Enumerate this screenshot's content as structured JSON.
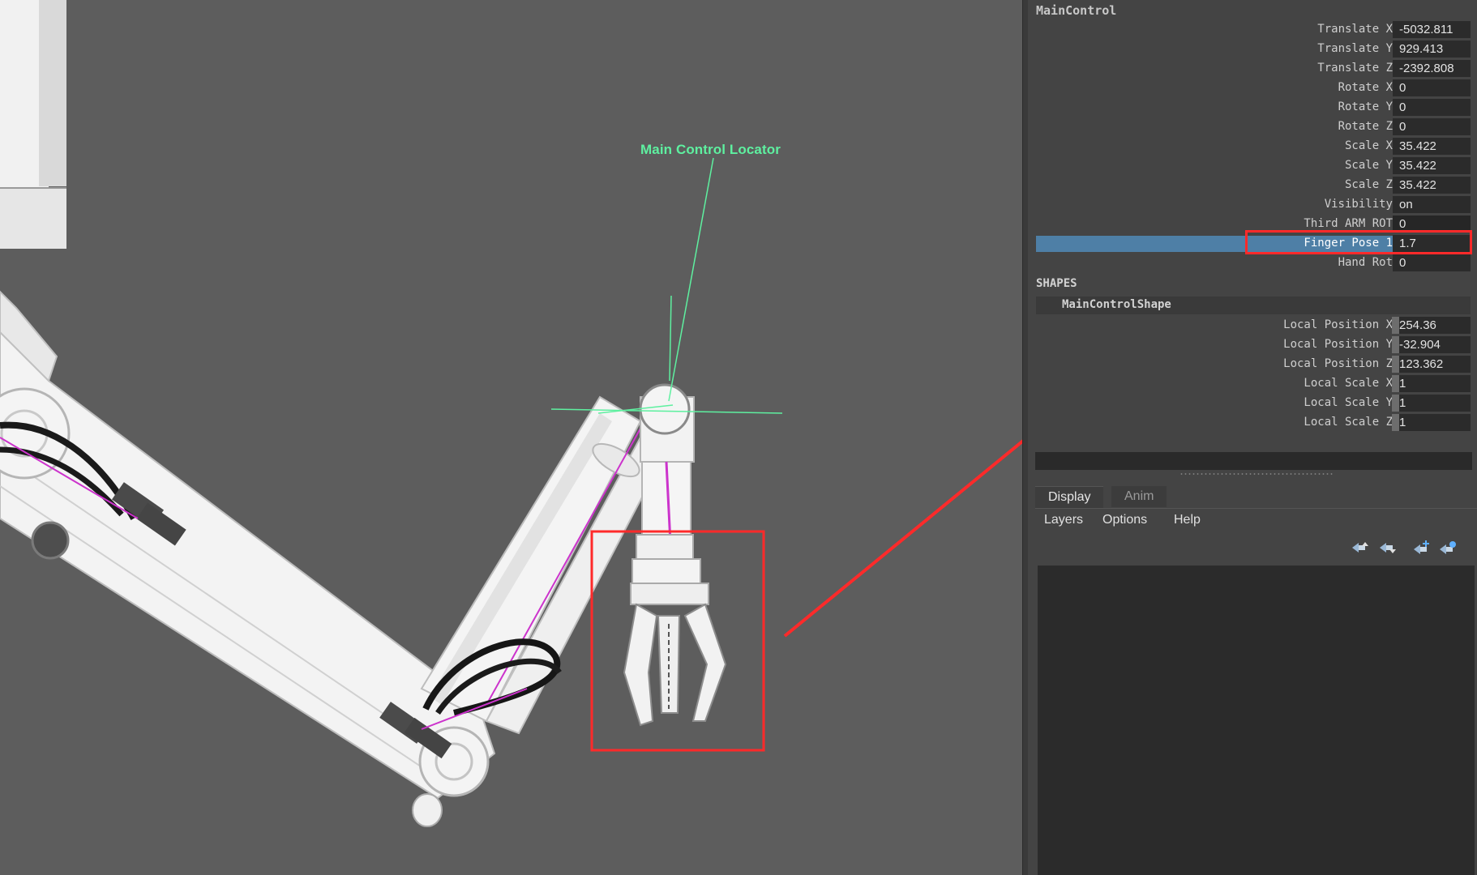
{
  "viewport": {
    "locator_label": "Main Control Locator"
  },
  "channel_box": {
    "object_name": "MainControl",
    "attributes": [
      {
        "label": "Translate X",
        "value": "-5032.811"
      },
      {
        "label": "Translate Y",
        "value": "929.413"
      },
      {
        "label": "Translate Z",
        "value": "-2392.808"
      },
      {
        "label": "Rotate X",
        "value": "0"
      },
      {
        "label": "Rotate Y",
        "value": "0"
      },
      {
        "label": "Rotate Z",
        "value": "0"
      },
      {
        "label": "Scale X",
        "value": "35.422"
      },
      {
        "label": "Scale Y",
        "value": "35.422"
      },
      {
        "label": "Scale Z",
        "value": "35.422"
      },
      {
        "label": "Visibility",
        "value": "on"
      },
      {
        "label": "Third ARM ROT",
        "value": "0"
      },
      {
        "label": "Finger Pose 1",
        "value": "1.7"
      },
      {
        "label": "Hand Rot",
        "value": "0"
      }
    ],
    "shapes_title": "SHAPES",
    "shape_name": "MainControlShape",
    "shape_attributes": [
      {
        "label": "Local Position X",
        "value": "254.36"
      },
      {
        "label": "Local Position Y",
        "value": "-32.904"
      },
      {
        "label": "Local Position Z",
        "value": "123.362"
      },
      {
        "label": "Local Scale X",
        "value": "1"
      },
      {
        "label": "Local Scale Y",
        "value": "1"
      },
      {
        "label": "Local Scale Z",
        "value": "1"
      }
    ]
  },
  "layer_editor": {
    "tabs": [
      "Display",
      "Anim"
    ],
    "menu": [
      "Layers",
      "Options",
      "Help"
    ],
    "tools": [
      "move-layer-up-icon",
      "move-layer-down-icon",
      "new-layer-icon",
      "new-layer-from-selected-icon"
    ]
  },
  "colors": {
    "locator": "#5ef0a0",
    "annotation": "#ff2a2a",
    "selection": "#4e7fa6"
  }
}
